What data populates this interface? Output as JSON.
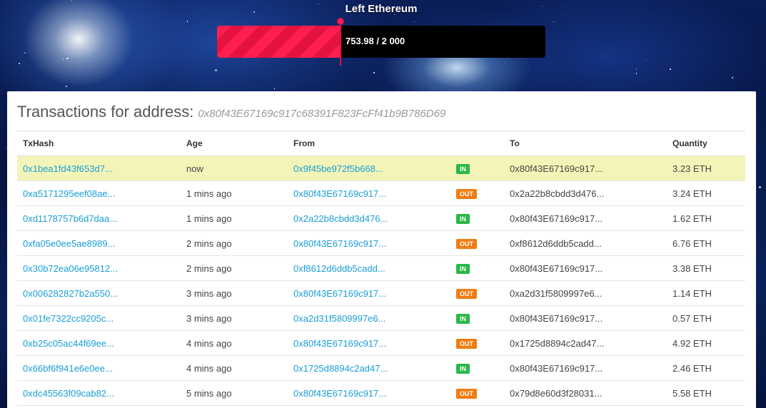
{
  "progress": {
    "title": "Left Ethereum",
    "text": "753.98 / 2 000",
    "current": 753.98,
    "max": 2000,
    "fill_color": "#ff1e4f"
  },
  "transactions": {
    "title": "Transactions for address:",
    "address": "0x80f43E67169c917c68391F823FcFf41b9B786D69",
    "columns": [
      "TxHash",
      "Age",
      "From",
      "",
      "To",
      "Quantity"
    ],
    "rows": [
      {
        "hash": "0x1bea1fd43f653d7...",
        "age": "now",
        "from": "0x9f45be972f5b668...",
        "dir": "IN",
        "to": "0x80f43E67169c917...",
        "qty": "3.23 ETH",
        "highlight": true
      },
      {
        "hash": "0xa5171295eef08ae...",
        "age": "1 mins ago",
        "from": "0x80f43E67169c917...",
        "dir": "OUT",
        "to": "0x2a22b8cbdd3d476...",
        "qty": "3.24 ETH"
      },
      {
        "hash": "0xd1178757b6d7daa...",
        "age": "1 mins ago",
        "from": "0x2a22b8cbdd3d476...",
        "dir": "IN",
        "to": "0x80f43E67169c917...",
        "qty": "1.62 ETH"
      },
      {
        "hash": "0xfa05e0ee5ae8989...",
        "age": "2 mins ago",
        "from": "0x80f43E67169c917...",
        "dir": "OUT",
        "to": "0xf8612d6ddb5cadd...",
        "qty": "6.76 ETH"
      },
      {
        "hash": "0x30b72ea06e95812...",
        "age": "2 mins ago",
        "from": "0xf8612d6ddb5cadd...",
        "dir": "IN",
        "to": "0x80f43E67169c917...",
        "qty": "3.38 ETH"
      },
      {
        "hash": "0x006282827b2a550...",
        "age": "3 mins ago",
        "from": "0x80f43E67169c917...",
        "dir": "OUT",
        "to": "0xa2d31f5809997e6...",
        "qty": "1.14 ETH"
      },
      {
        "hash": "0x01fe7322cc9205c...",
        "age": "3 mins ago",
        "from": "0xa2d31f5809997e6...",
        "dir": "IN",
        "to": "0x80f43E67169c917...",
        "qty": "0.57 ETH"
      },
      {
        "hash": "0xb25c05ac44f69ee...",
        "age": "4 mins ago",
        "from": "0x80f43E67169c917...",
        "dir": "OUT",
        "to": "0x1725d8894c2ad47...",
        "qty": "4.92 ETH"
      },
      {
        "hash": "0x66bf6f941e6e0ee...",
        "age": "4 mins ago",
        "from": "0x1725d8894c2ad47...",
        "dir": "IN",
        "to": "0x80f43E67169c917...",
        "qty": "2.46 ETH"
      },
      {
        "hash": "0xdc45563f09cab82...",
        "age": "5 mins ago",
        "from": "0x80f43E67169c917...",
        "dir": "OUT",
        "to": "0x79d8e60d3f28031...",
        "qty": "5.58 ETH"
      }
    ]
  }
}
